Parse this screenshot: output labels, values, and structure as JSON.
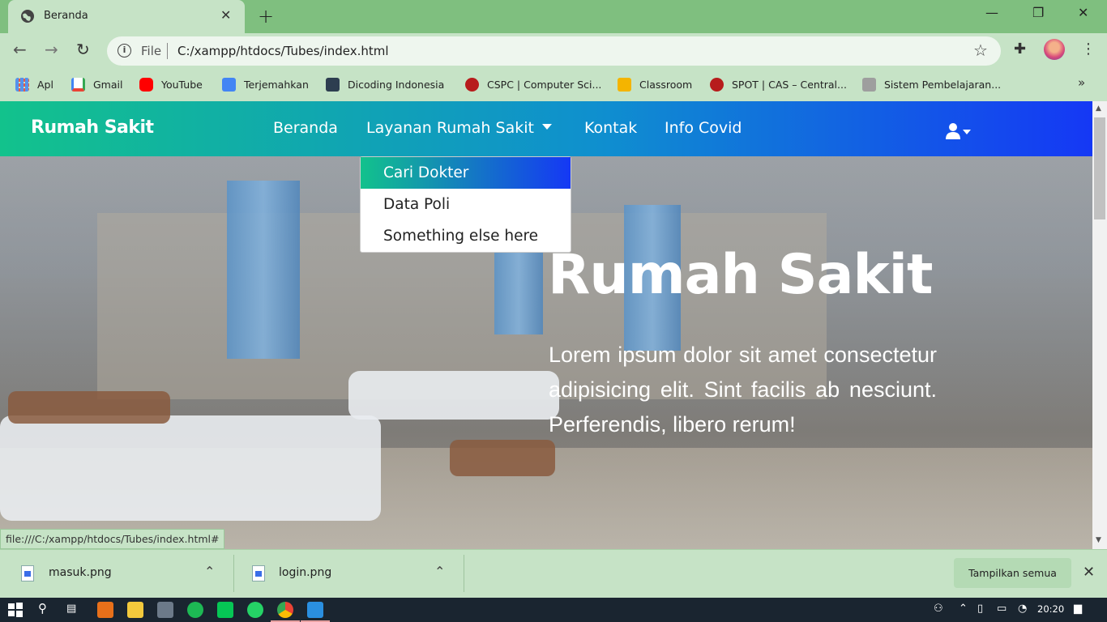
{
  "browser": {
    "tab_title": "Beranda",
    "url_scheme": "File",
    "url": "C:/xampp/htdocs/Tubes/index.html",
    "status_url": "file:///C:/xampp/htdocs/Tubes/index.html#"
  },
  "bookmarks": [
    {
      "label": "Apl",
      "icon": "apps-grid-icon",
      "color": "#4285f4"
    },
    {
      "label": "Gmail",
      "icon": "gmail-icon",
      "color": "#ea4335"
    },
    {
      "label": "YouTube",
      "icon": "youtube-icon",
      "color": "#ff0000"
    },
    {
      "label": "Terjemahkan",
      "icon": "translate-icon",
      "color": "#4285f4"
    },
    {
      "label": "Dicoding Indonesia",
      "icon": "dicoding-icon",
      "color": "#2d3e50"
    },
    {
      "label": "CSPC | Computer Sci...",
      "icon": "telkom-icon",
      "color": "#b71c1c"
    },
    {
      "label": "Classroom",
      "icon": "classroom-icon",
      "color": "#f4b400"
    },
    {
      "label": "SPOT | CAS – Central...",
      "icon": "telkom-icon",
      "color": "#b71c1c"
    },
    {
      "label": "Sistem Pembelajaran...",
      "icon": "lms-icon",
      "color": "#9e9e9e"
    }
  ],
  "site": {
    "brand": "Rumah Sakit",
    "nav": {
      "beranda": "Beranda",
      "layanan": "Layanan Rumah Sakit",
      "kontak": "Kontak",
      "info_covid": "Info Covid"
    },
    "dropdown": [
      "Cari Dokter",
      "Data Poli",
      "Something else here"
    ],
    "hero_title": "Rumah Sakit",
    "hero_text": "Lorem ipsum dolor sit amet consectetur adipisicing elit. Sint facilis ab nesciunt. Perferendis, libero rerum!",
    "gradient_start": "#12c28c",
    "gradient_end": "#1538f5"
  },
  "downloads": {
    "items": [
      "masuk.png",
      "login.png"
    ],
    "show_all": "Tampilkan semua"
  },
  "taskbar": {
    "clock": "20:20"
  }
}
